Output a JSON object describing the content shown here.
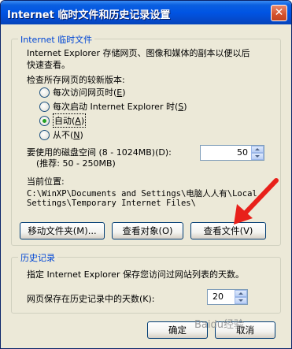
{
  "window": {
    "title": "Internet 临时文件和历史记录设置",
    "close_symbol": "✕"
  },
  "temp_files": {
    "group_title": "Internet 临时文件",
    "description_line1": "Internet Explorer 存储网页、图像和媒体的副本以便以后",
    "description_line2": "快速查看。",
    "check_label": "检查所存网页的较新版本:",
    "options": [
      {
        "label": "每次访问网页时(",
        "key": "E",
        "suffix": ")",
        "checked": false
      },
      {
        "label": "每次启动 Internet Explorer 时(",
        "key": "S",
        "suffix": ")",
        "checked": false
      },
      {
        "label": "自动(",
        "key": "A",
        "suffix": ")",
        "checked": true
      },
      {
        "label": "从不(",
        "key": "N",
        "suffix": ")",
        "checked": false
      }
    ],
    "disk_space_label": "要使用的磁盘空间 (8 - 1024MB)(D):",
    "disk_space_hint": "(推荐: 50 - 250MB)",
    "disk_space_value": "50",
    "current_location_label": "当前位置:",
    "current_location_line1": "C:\\WinXP\\Documents and Settings\\电脑人人有\\Local",
    "current_location_line2": "Settings\\Temporary Internet Files\\",
    "buttons": {
      "move_folder": "移动文件夹(M)...",
      "view_objects": "查看对象(O)",
      "view_files": "查看文件(V)"
    }
  },
  "history": {
    "group_title": "历史记录",
    "description": "指定 Internet Explorer 保存您访问过网站列表的天数。",
    "days_label": "网页保存在历史记录中的天数(K):",
    "days_value": "20"
  },
  "footer": {
    "ok": "确定",
    "cancel": "取消"
  },
  "watermark": "Baidu经验",
  "colors": {
    "title_bar": "#0054e3",
    "group_title": "#0046d5",
    "annotation_arrow": "#e8201a"
  }
}
